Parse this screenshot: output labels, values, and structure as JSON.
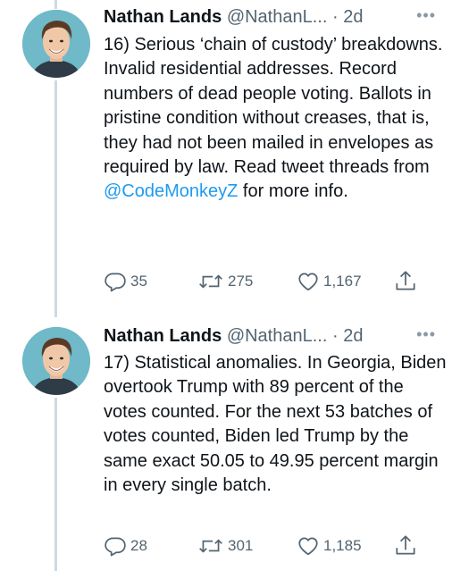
{
  "tweets": [
    {
      "display_name": "Nathan Lands",
      "handle": "@NathanL...",
      "separator": "·",
      "time": "2d",
      "more_icon": "more-dots-icon",
      "text_before_mention": "16) Serious ‘chain of custody’ breakdowns. Invalid residential addresses. Record numbers of dead people voting. Ballots in pristine condition without creases, that is, they had not been mailed in envelopes as required by law. Read tweet threads from ",
      "mention": "@CodeMonkeyZ",
      "text_after_mention": " for more info.",
      "reply_count": "35",
      "retweet_count": "275",
      "like_count": "1,167"
    },
    {
      "display_name": "Nathan Lands",
      "handle": "@NathanL...",
      "separator": "·",
      "time": "2d",
      "more_icon": "more-dots-icon",
      "text_before_mention": "17) Statistical anomalies. In Georgia, Biden overtook Trump with 89 percent of the votes counted. For the next 53 batches of votes counted, Biden led Trump by the same exact 50.05 to 49.95 percent margin in every single batch.",
      "mention": "",
      "text_after_mention": "",
      "reply_count": "28",
      "retweet_count": "301",
      "like_count": "1,185"
    }
  ],
  "icons": {
    "reply": "reply-icon",
    "retweet": "retweet-icon",
    "like": "heart-icon",
    "share": "share-icon"
  },
  "colors": {
    "text": "#0f1419",
    "secondary": "#536471",
    "mention": "#1d9bf0",
    "thread_line": "#cfd9de"
  }
}
